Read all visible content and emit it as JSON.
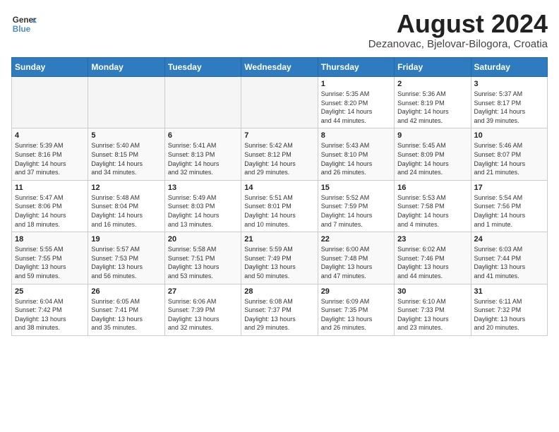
{
  "header": {
    "logo_line1": "General",
    "logo_line2": "Blue",
    "month": "August 2024",
    "location": "Dezanovac, Bjelovar-Bilogora, Croatia"
  },
  "weekdays": [
    "Sunday",
    "Monday",
    "Tuesday",
    "Wednesday",
    "Thursday",
    "Friday",
    "Saturday"
  ],
  "weeks": [
    [
      {
        "day": "",
        "info": ""
      },
      {
        "day": "",
        "info": ""
      },
      {
        "day": "",
        "info": ""
      },
      {
        "day": "",
        "info": ""
      },
      {
        "day": "1",
        "info": "Sunrise: 5:35 AM\nSunset: 8:20 PM\nDaylight: 14 hours\nand 44 minutes."
      },
      {
        "day": "2",
        "info": "Sunrise: 5:36 AM\nSunset: 8:19 PM\nDaylight: 14 hours\nand 42 minutes."
      },
      {
        "day": "3",
        "info": "Sunrise: 5:37 AM\nSunset: 8:17 PM\nDaylight: 14 hours\nand 39 minutes."
      }
    ],
    [
      {
        "day": "4",
        "info": "Sunrise: 5:39 AM\nSunset: 8:16 PM\nDaylight: 14 hours\nand 37 minutes."
      },
      {
        "day": "5",
        "info": "Sunrise: 5:40 AM\nSunset: 8:15 PM\nDaylight: 14 hours\nand 34 minutes."
      },
      {
        "day": "6",
        "info": "Sunrise: 5:41 AM\nSunset: 8:13 PM\nDaylight: 14 hours\nand 32 minutes."
      },
      {
        "day": "7",
        "info": "Sunrise: 5:42 AM\nSunset: 8:12 PM\nDaylight: 14 hours\nand 29 minutes."
      },
      {
        "day": "8",
        "info": "Sunrise: 5:43 AM\nSunset: 8:10 PM\nDaylight: 14 hours\nand 26 minutes."
      },
      {
        "day": "9",
        "info": "Sunrise: 5:45 AM\nSunset: 8:09 PM\nDaylight: 14 hours\nand 24 minutes."
      },
      {
        "day": "10",
        "info": "Sunrise: 5:46 AM\nSunset: 8:07 PM\nDaylight: 14 hours\nand 21 minutes."
      }
    ],
    [
      {
        "day": "11",
        "info": "Sunrise: 5:47 AM\nSunset: 8:06 PM\nDaylight: 14 hours\nand 18 minutes."
      },
      {
        "day": "12",
        "info": "Sunrise: 5:48 AM\nSunset: 8:04 PM\nDaylight: 14 hours\nand 16 minutes."
      },
      {
        "day": "13",
        "info": "Sunrise: 5:49 AM\nSunset: 8:03 PM\nDaylight: 14 hours\nand 13 minutes."
      },
      {
        "day": "14",
        "info": "Sunrise: 5:51 AM\nSunset: 8:01 PM\nDaylight: 14 hours\nand 10 minutes."
      },
      {
        "day": "15",
        "info": "Sunrise: 5:52 AM\nSunset: 7:59 PM\nDaylight: 14 hours\nand 7 minutes."
      },
      {
        "day": "16",
        "info": "Sunrise: 5:53 AM\nSunset: 7:58 PM\nDaylight: 14 hours\nand 4 minutes."
      },
      {
        "day": "17",
        "info": "Sunrise: 5:54 AM\nSunset: 7:56 PM\nDaylight: 14 hours\nand 1 minute."
      }
    ],
    [
      {
        "day": "18",
        "info": "Sunrise: 5:55 AM\nSunset: 7:55 PM\nDaylight: 13 hours\nand 59 minutes."
      },
      {
        "day": "19",
        "info": "Sunrise: 5:57 AM\nSunset: 7:53 PM\nDaylight: 13 hours\nand 56 minutes."
      },
      {
        "day": "20",
        "info": "Sunrise: 5:58 AM\nSunset: 7:51 PM\nDaylight: 13 hours\nand 53 minutes."
      },
      {
        "day": "21",
        "info": "Sunrise: 5:59 AM\nSunset: 7:49 PM\nDaylight: 13 hours\nand 50 minutes."
      },
      {
        "day": "22",
        "info": "Sunrise: 6:00 AM\nSunset: 7:48 PM\nDaylight: 13 hours\nand 47 minutes."
      },
      {
        "day": "23",
        "info": "Sunrise: 6:02 AM\nSunset: 7:46 PM\nDaylight: 13 hours\nand 44 minutes."
      },
      {
        "day": "24",
        "info": "Sunrise: 6:03 AM\nSunset: 7:44 PM\nDaylight: 13 hours\nand 41 minutes."
      }
    ],
    [
      {
        "day": "25",
        "info": "Sunrise: 6:04 AM\nSunset: 7:42 PM\nDaylight: 13 hours\nand 38 minutes."
      },
      {
        "day": "26",
        "info": "Sunrise: 6:05 AM\nSunset: 7:41 PM\nDaylight: 13 hours\nand 35 minutes."
      },
      {
        "day": "27",
        "info": "Sunrise: 6:06 AM\nSunset: 7:39 PM\nDaylight: 13 hours\nand 32 minutes."
      },
      {
        "day": "28",
        "info": "Sunrise: 6:08 AM\nSunset: 7:37 PM\nDaylight: 13 hours\nand 29 minutes."
      },
      {
        "day": "29",
        "info": "Sunrise: 6:09 AM\nSunset: 7:35 PM\nDaylight: 13 hours\nand 26 minutes."
      },
      {
        "day": "30",
        "info": "Sunrise: 6:10 AM\nSunset: 7:33 PM\nDaylight: 13 hours\nand 23 minutes."
      },
      {
        "day": "31",
        "info": "Sunrise: 6:11 AM\nSunset: 7:32 PM\nDaylight: 13 hours\nand 20 minutes."
      }
    ]
  ]
}
